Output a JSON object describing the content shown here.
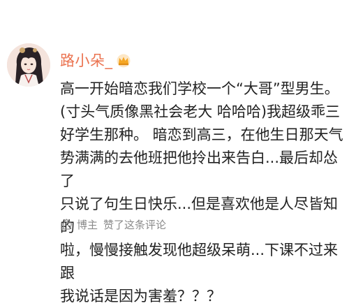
{
  "comment": {
    "username": "路小朵_",
    "vip_badge_icon": "crown-icon",
    "text": "高一开始暗恋我们学校一个“大哥”型男生。\n(寸头气质像黑社会老大 哈哈哈)我超级乖三\n好学生那种。 暗恋到高三，在他生日那天气\n势满满的去他班把他拎出来告白...最后却怂了\n只说了句生日快乐...但是喜欢他是人尽皆知的\n啦，慢慢接触发现他超级呆萌...下课不过来跟\n我说话是因为害羞？？？",
    "footer": {
      "like_icon": "thumbs-up-icon",
      "author_label": "博主",
      "liked_text": "赞了这条评论"
    }
  },
  "colors": {
    "username": "#eb7350",
    "text": "#222222",
    "muted": "#8a8a8a",
    "badge": "#f5a623"
  }
}
